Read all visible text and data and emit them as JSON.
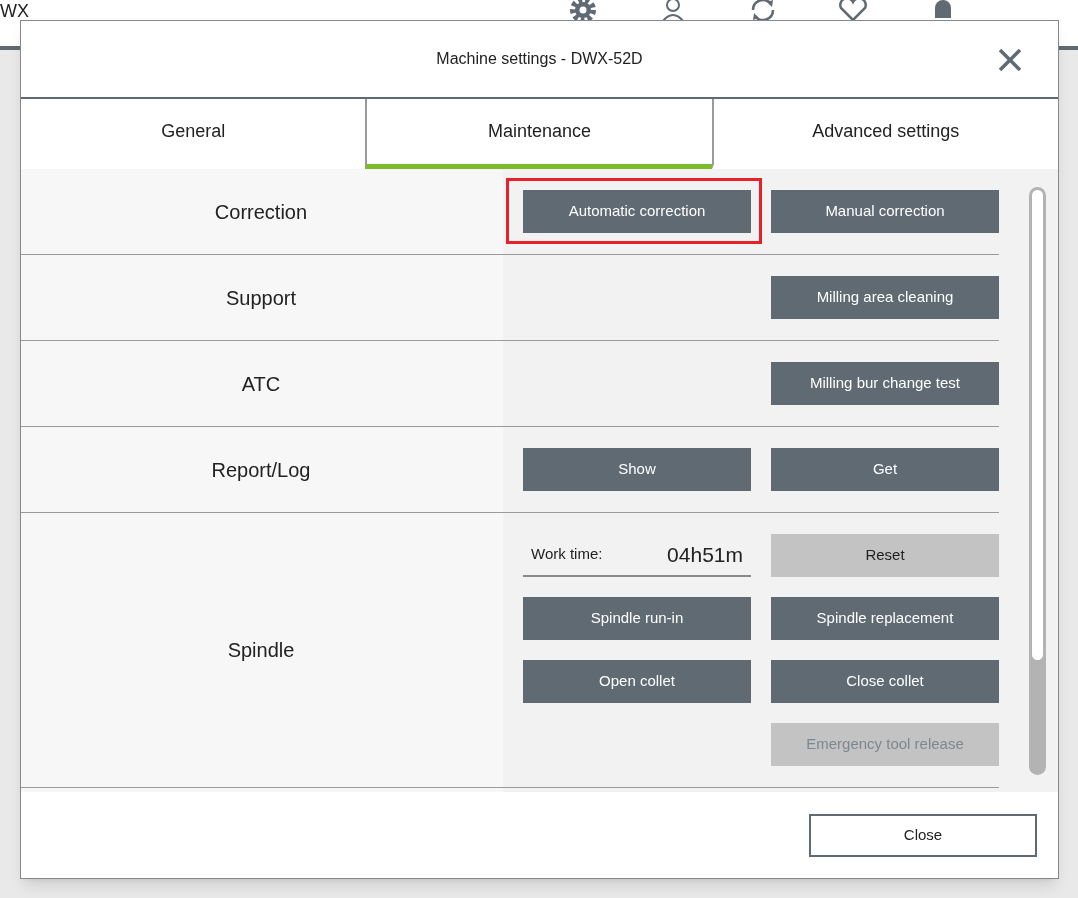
{
  "app": {
    "title": "WX"
  },
  "dialog": {
    "title": "Machine settings - DWX-52D",
    "tabs": [
      {
        "label": "General",
        "selected": false
      },
      {
        "label": "Maintenance",
        "selected": true
      },
      {
        "label": "Advanced settings",
        "selected": false
      }
    ],
    "sections": [
      {
        "label": "Correction",
        "rows": [
          {
            "left": {
              "kind": "primary",
              "label": "Automatic correction",
              "disabled": false,
              "highlighted": true
            },
            "right": {
              "kind": "primary",
              "label": "Manual correction",
              "disabled": false,
              "highlighted": false
            }
          }
        ]
      },
      {
        "label": "Support",
        "rows": [
          {
            "right": {
              "kind": "primary",
              "label": "Milling area cleaning",
              "disabled": false,
              "highlighted": false
            }
          }
        ]
      },
      {
        "label": "ATC",
        "rows": [
          {
            "right": {
              "kind": "primary",
              "label": "Milling bur change test",
              "disabled": false,
              "highlighted": false
            }
          }
        ]
      },
      {
        "label": "Report/Log",
        "rows": [
          {
            "left": {
              "kind": "primary",
              "label": "Show",
              "disabled": false,
              "highlighted": false
            },
            "right": {
              "kind": "primary",
              "label": "Get",
              "disabled": false,
              "highlighted": false
            }
          }
        ]
      },
      {
        "label": "Spindle",
        "rows": [
          {
            "left": {
              "kind": "readout",
              "label": "Work time:",
              "value": "04h51m"
            },
            "right": {
              "kind": "secondary",
              "label": "Reset",
              "disabled": false,
              "highlighted": false
            }
          },
          {
            "left": {
              "kind": "primary",
              "label": "Spindle run-in",
              "disabled": false,
              "highlighted": false
            },
            "right": {
              "kind": "primary",
              "label": "Spindle replacement",
              "disabled": false,
              "highlighted": false
            }
          },
          {
            "left": {
              "kind": "primary",
              "label": "Open collet",
              "disabled": false,
              "highlighted": false
            },
            "right": {
              "kind": "primary",
              "label": "Close collet",
              "disabled": false,
              "highlighted": false
            }
          },
          {
            "right": {
              "kind": "secondary",
              "label": "Emergency tool release",
              "disabled": true,
              "highlighted": false
            }
          }
        ]
      }
    ],
    "footer_button": "Close"
  }
}
